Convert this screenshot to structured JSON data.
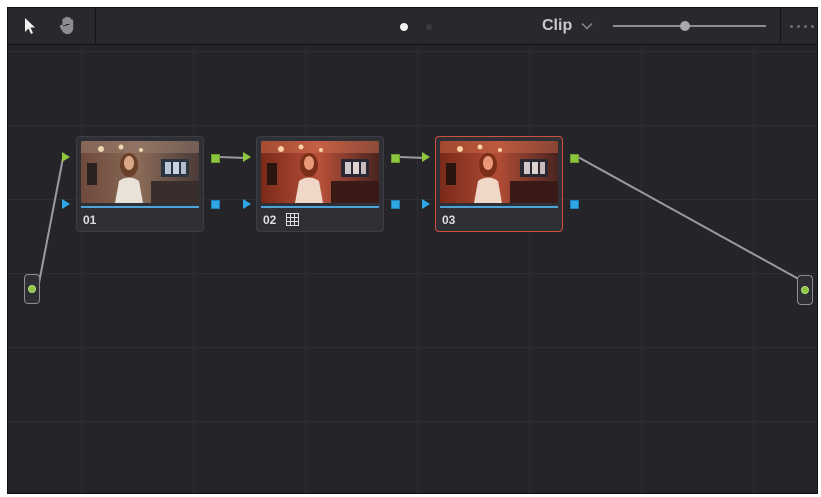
{
  "toolbar": {
    "pointer_tool_icon": "arrow-pointer-icon",
    "hand_tool_icon": "hand-pan-icon",
    "mode_label": "Clip",
    "mode_chevron_icon": "chevron-down-icon",
    "zoom_level": 0.47,
    "options_icon": "more-options-icon"
  },
  "nodes": [
    {
      "label": "01",
      "selected": false,
      "grade": "natural"
    },
    {
      "label": "02",
      "selected": false,
      "grade": "warm",
      "badge_icon": "grid-icon"
    },
    {
      "label": "03",
      "selected": true,
      "grade": "warm"
    }
  ],
  "colors": {
    "rgb_port": "#8cc63f",
    "key_port": "#2fa7e6",
    "selected_border": "#d0503f",
    "canvas_bg": "#242429"
  }
}
